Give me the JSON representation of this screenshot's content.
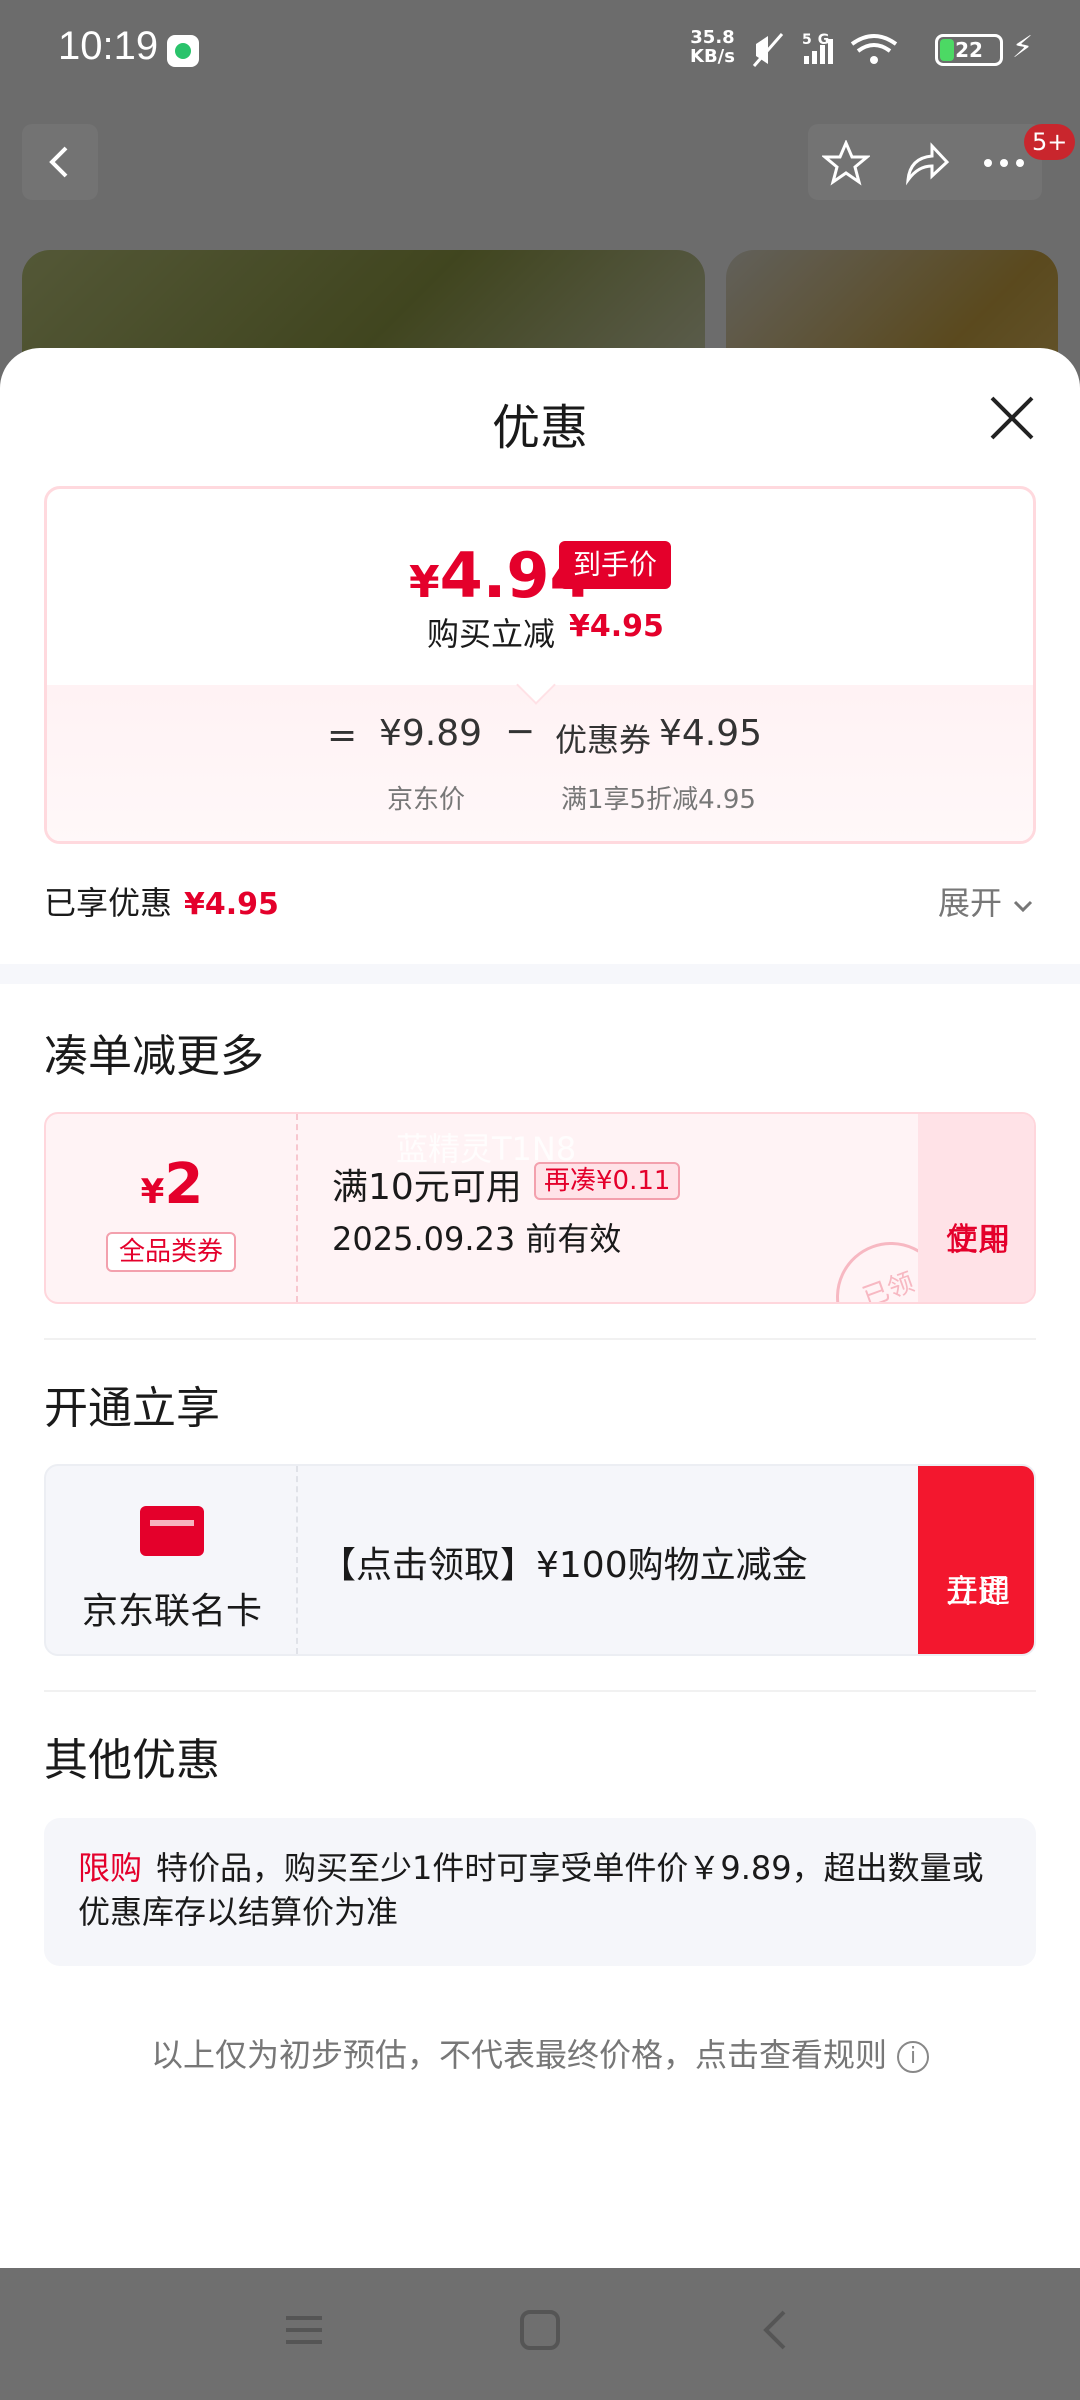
{
  "status_bar": {
    "time": "10:19",
    "net_speed_top": "35.8",
    "net_speed_bottom": "KB/s",
    "network": "5G",
    "battery": "22"
  },
  "background": {
    "notification_badge": "5+"
  },
  "sheet": {
    "title": "优惠",
    "summary": {
      "currency": "¥",
      "final_price": "4.94",
      "final_tag": "到手价",
      "instant_label": "购买立减",
      "instant_value": "¥4.95",
      "equals": "=",
      "jd_price": "¥9.89",
      "minus": "−",
      "coupon_label": "优惠券",
      "coupon_value": "¥4.95",
      "jd_price_caption": "京东价",
      "coupon_caption": "满1享5折减4.95"
    },
    "enjoyed_label": "已享优惠",
    "enjoyed_value": "¥4.95",
    "expand_label": "展开",
    "section_more": {
      "title": "凑单减更多",
      "coupon": {
        "currency": "¥",
        "amount": "2",
        "type": "全品类券",
        "condition": "满10元可用",
        "more_needed": "再凑¥0.11",
        "valid": "2025.09.23 前有效",
        "action_line1": "立即",
        "action_line2": "使用",
        "stamp": "已领",
        "watermark": "蓝精灵T1N8"
      }
    },
    "section_open": {
      "title": "开通立享",
      "card_name": "京东联名卡",
      "card_desc": "【点击领取】¥100购物立减金",
      "action_line1": "立即",
      "action_line2": "开通"
    },
    "section_other": {
      "title": "其他优惠",
      "tag": "限购",
      "text": "特价品，购买至少1件时可享受单件价￥9.89，超出数量或优惠库存以结算价为准"
    },
    "disclaimer": "以上仅为初步预估，不代表最终价格，点击查看规则"
  },
  "colors": {
    "accent_red": "#e4002b",
    "open_button": "#f3172e"
  }
}
